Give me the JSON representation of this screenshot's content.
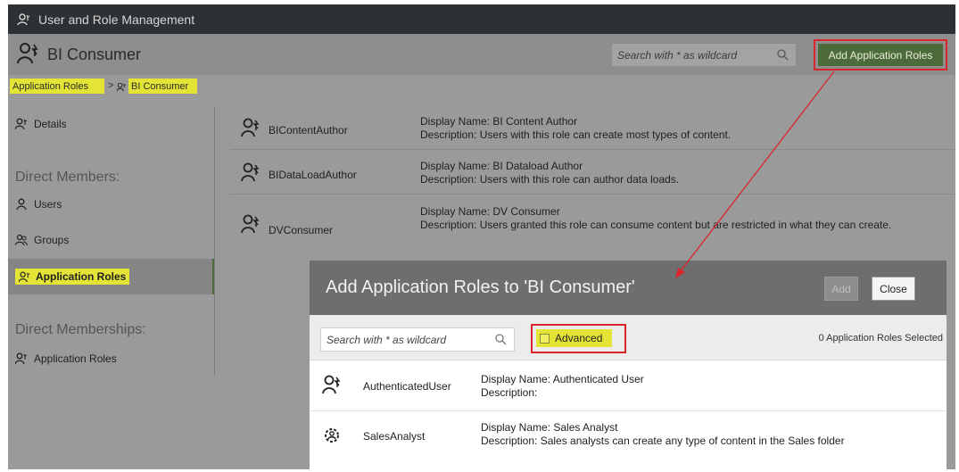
{
  "window": {
    "title": "User and Role Management"
  },
  "header": {
    "title": "BI Consumer",
    "search_placeholder": "Search with * as wildcard",
    "add_button_label": "Add Application Roles"
  },
  "breadcrumb": {
    "parent": "Application Roles",
    "separator": ">",
    "current": "BI Consumer"
  },
  "sidebar": {
    "details": "Details",
    "direct_members_heading": "Direct Members:",
    "users": "Users",
    "groups": "Groups",
    "application_roles": "Application Roles",
    "direct_memberships_heading": "Direct Memberships:",
    "memberships_application_roles": "Application Roles"
  },
  "roles": [
    {
      "name": "BIContentAuthor",
      "display": "Display Name: BI Content Author",
      "desc": "Description: Users with this role can create most types of content."
    },
    {
      "name": "BIDataLoadAuthor",
      "display": "Display Name: BI Dataload Author",
      "desc": "Description: Users with this role can author data loads."
    },
    {
      "name": "DVConsumer",
      "display": "Display Name: DV Consumer",
      "desc": "Description: Users granted this role can consume content but are restricted in what they can create."
    }
  ],
  "dialog": {
    "title": "Add Application Roles to 'BI Consumer'",
    "add_label": "Add",
    "close_label": "Close",
    "search_placeholder": "Search with * as wildcard",
    "advanced_label": "Advanced",
    "selected_count": "0 Application Roles Selected",
    "items": [
      {
        "name": "AuthenticatedUser",
        "display": "Display Name: Authenticated User",
        "desc": "Description:",
        "icon": "role-icon"
      },
      {
        "name": "SalesAnalyst",
        "display": "Display Name: Sales Analyst",
        "desc": "Description: Sales analysts can create any type of content in the Sales folder",
        "icon": "role-gear-icon"
      }
    ]
  },
  "colors": {
    "accent_green": "#4c6a3a",
    "highlight_yellow": "#e4e436",
    "annotation_red": "#d9252b"
  }
}
